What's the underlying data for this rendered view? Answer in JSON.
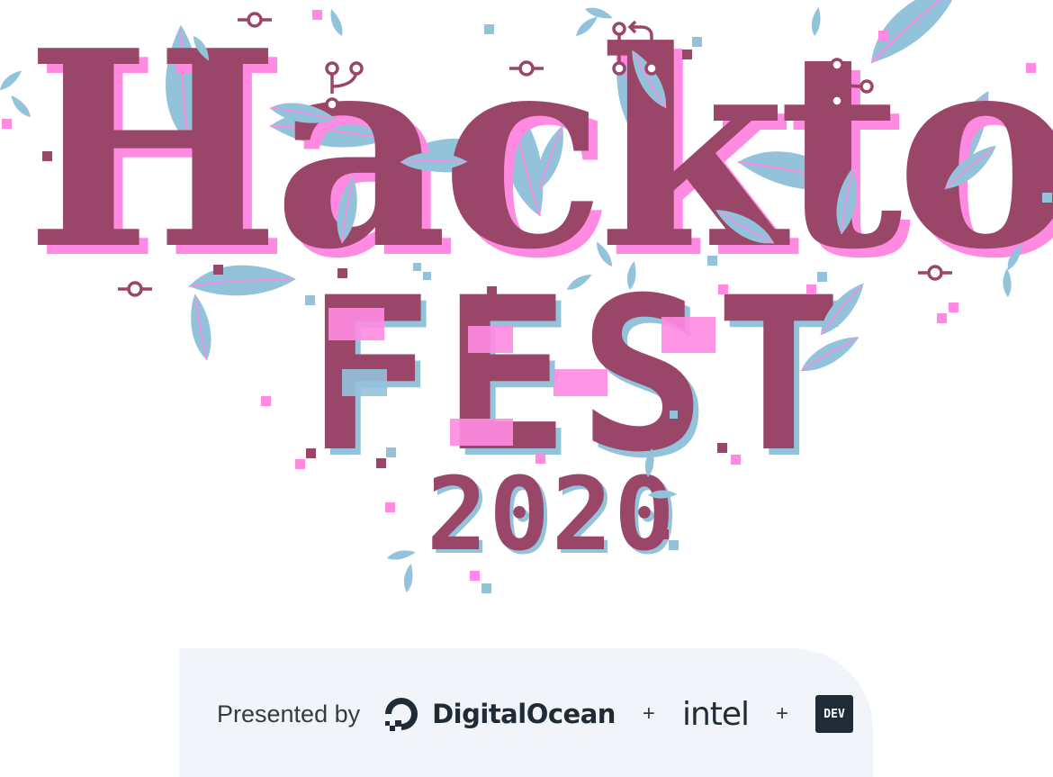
{
  "artwork": {
    "title_word": "Hacktober",
    "subtitle_word": "FEST",
    "year": "2020",
    "colors": {
      "plum": "#9a4669",
      "pink": "#ff8ae2",
      "leaf_blue": "#93c2db",
      "white": "#ffffff"
    },
    "decorative_icons": [
      "leaf-icon",
      "git-commit-icon",
      "git-merge-icon",
      "git-pull-request-icon",
      "pixel-square-icon"
    ]
  },
  "sponsors": {
    "presented_label": "Presented by",
    "digitalocean": {
      "name": "DigitalOcean",
      "icon": "digitalocean-logo-icon",
      "color": "#1f2b36"
    },
    "intel": {
      "name": "intel"
    },
    "dev": {
      "badge": "DEV"
    },
    "separator": "+",
    "background": "#f1f5f9"
  }
}
